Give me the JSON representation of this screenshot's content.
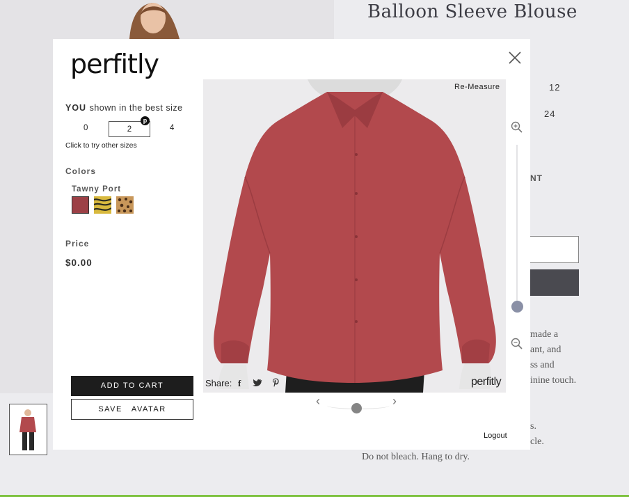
{
  "page": {
    "product_title": "Balloon Sleeve Blouse",
    "size_values": [
      "12",
      "24"
    ],
    "partial_label": "NT",
    "description_fragments": [
      "made a",
      "ant, and",
      "ss and",
      "inine touch."
    ],
    "care_fragments": [
      "s.",
      "cle.",
      "Do not bleach. Hang to dry."
    ]
  },
  "modal": {
    "logo_text": "perfitly",
    "close_icon": "close-icon",
    "best_size_prefix": "YOU",
    "best_size_text": "shown in the best size",
    "sizes": [
      "0",
      "2",
      "4"
    ],
    "selected_size": "2",
    "size_badge": "p",
    "size_hint": "Click to try other sizes",
    "colors_label": "Colors",
    "selected_color_name": "Tawny Port",
    "color_swatches": [
      {
        "name": "tawny-port",
        "color": "#9c4046",
        "selected": true
      },
      {
        "name": "zebra-print",
        "color": "#d8b93e",
        "selected": false
      },
      {
        "name": "leopard-print",
        "color": "#c8975a",
        "selected": false
      }
    ],
    "price_label": "Price",
    "price_value": "$0.00",
    "add_to_cart_label": "ADD TO CART",
    "save_avatar_label": "SAVE   AVATAR",
    "remeasure_label": "Re-Measure",
    "share_label": "Share:",
    "share_icons": [
      "facebook-icon",
      "twitter-icon",
      "pinterest-icon"
    ],
    "viewer_logo": "perfitly",
    "logout_label": "Logout",
    "garment_color": "#b2494d"
  }
}
